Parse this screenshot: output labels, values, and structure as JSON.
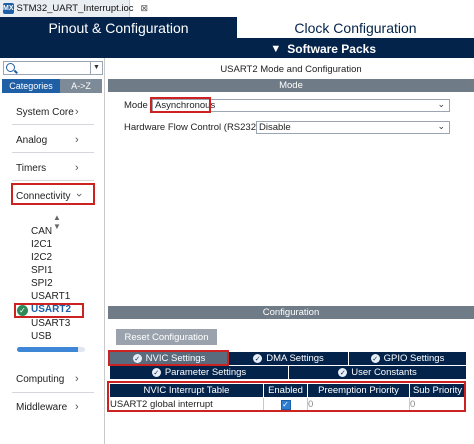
{
  "file_tab": {
    "icon": "mx-icon",
    "title": "STM32_UART_Interrupt.ioc",
    "close": "⊠"
  },
  "header": {
    "pinout_tab": "Pinout & Configuration",
    "clock_tab": "Clock Configuration",
    "software_packs": "Software Packs"
  },
  "sidebar": {
    "tabs": [
      "Categories",
      "A->Z"
    ],
    "categories": [
      "System Core",
      "Analog",
      "Timers",
      "Connectivity",
      "Computing",
      "Middleware"
    ],
    "connectivity_items": [
      "CAN",
      "I2C1",
      "I2C2",
      "SPI1",
      "SPI2",
      "USART1",
      "USART2",
      "USART3",
      "USB"
    ],
    "selected_item": "USART2",
    "scroll_progress": 0.9
  },
  "mode_panel": {
    "title": "USART2 Mode and Configuration",
    "section": "Mode",
    "mode_label": "Mode",
    "mode_value": "Asynchronous",
    "flow_label": "Hardware Flow Control (RS232)",
    "flow_value": "Disable"
  },
  "config_panel": {
    "section": "Configuration",
    "reset_button": "Reset Configuration",
    "tabs_row1": [
      "NVIC Settings",
      "DMA Settings",
      "GPIO Settings"
    ],
    "tabs_row2": [
      "Parameter Settings",
      "User Constants"
    ],
    "active_tab": "NVIC Settings",
    "table": {
      "headers": [
        "NVIC Interrupt Table",
        "Enabled",
        "Preemption Priority",
        "Sub Priority"
      ],
      "rows": [
        {
          "name": "USART2 global interrupt",
          "enabled": true,
          "preemption": "0",
          "sub": "0"
        }
      ]
    }
  },
  "colors": {
    "navy": "#03234b",
    "accent": "#1f5fa6",
    "highlight_red": "#cc2222",
    "grey_bar": "#6f7b87"
  }
}
